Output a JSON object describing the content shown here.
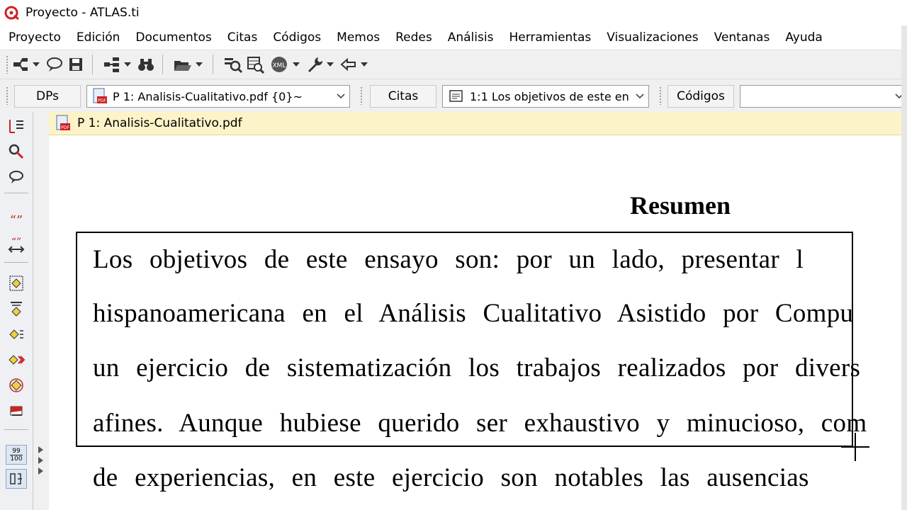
{
  "window": {
    "title": "Proyecto - ATLAS.ti"
  },
  "menu": [
    "Proyecto",
    "Edición",
    "Documentos",
    "Citas",
    "Códigos",
    "Memos",
    "Redes",
    "Análisis",
    "Herramientas",
    "Visualizaciones",
    "Ventanas",
    "Ayuda"
  ],
  "selector": {
    "docs_label": "DPs",
    "docs_value": "P 1: Analisis-Cualitativo.pdf {0}~",
    "quotes_label": "Citas",
    "quotes_value": "1:1 Los objetivos de este en",
    "codes_label": "Códigos",
    "codes_value": ""
  },
  "left_toolbar": {
    "count_label_top": "99",
    "count_label_bottom": "100"
  },
  "doc_tab": {
    "title": "P 1: Analisis-Cualitativo.pdf"
  },
  "document": {
    "heading": "Resumen",
    "lines": [
      "Los objetivos de este ensayo son: por un lado, presentar l",
      "hispanoamericana en el Análisis Cualitativo Asistido por Compu",
      "un ejercicio de sistematización los trabajos realizados por divers",
      "afines. Aunque hubiese querido ser exhaustivo y minucioso, com",
      "de experiencias, en este ejercicio son notables las ausencias"
    ]
  },
  "colors": {
    "doc_tab_bg": "#fdf3c8",
    "logo_red": "#cc2222"
  }
}
